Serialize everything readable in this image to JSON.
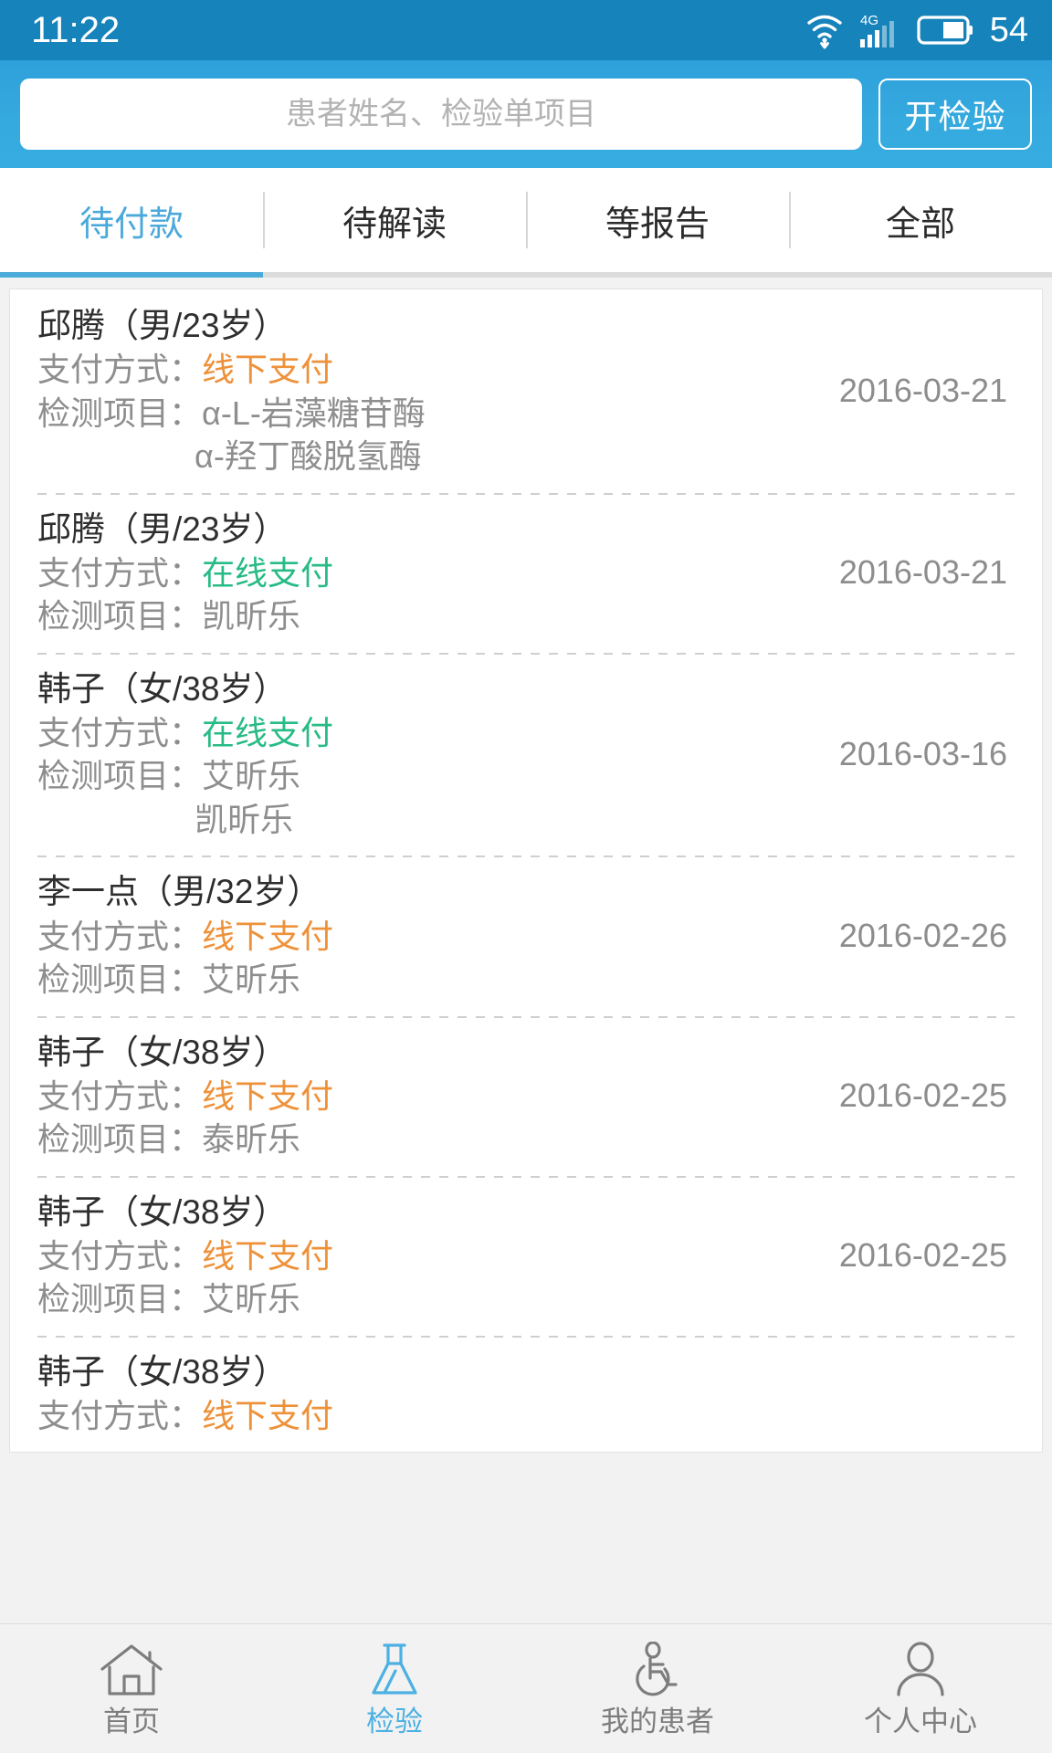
{
  "status_bar": {
    "time": "11:22",
    "battery_level": "54",
    "network_label": "4G",
    "icons": [
      "wifi-download-icon",
      "signal-4g-icon",
      "battery-icon"
    ]
  },
  "header": {
    "search_placeholder": "患者姓名、检验单项目",
    "search_value": "",
    "action_button": "开检验"
  },
  "tabs": {
    "items": [
      {
        "label": "待付款",
        "active": true
      },
      {
        "label": "待解读",
        "active": false
      },
      {
        "label": "等报告",
        "active": false
      },
      {
        "label": "全部",
        "active": false
      }
    ]
  },
  "labels": {
    "payment_prefix": "支付方式：",
    "items_prefix": "检测项目："
  },
  "colors": {
    "status_bar_bg": "#1783bb",
    "header_bg": "#35aade",
    "accent": "#4bacd9",
    "offline_pay": "#ee9139",
    "online_pay": "#27bb85",
    "text_primary": "#2e2e2e",
    "text_secondary": "#8e8e8e"
  },
  "list": {
    "rows": [
      {
        "patient": "邱腾（男/23岁）",
        "payment": "线下支付",
        "payment_type": "offline",
        "items": [
          "α-L-岩藻糖苷酶",
          "α-羟丁酸脱氢酶"
        ],
        "date": "2016-03-21"
      },
      {
        "patient": "邱腾（男/23岁）",
        "payment": "在线支付",
        "payment_type": "online",
        "items": [
          "凯昕乐"
        ],
        "date": "2016-03-21"
      },
      {
        "patient": "韩子（女/38岁）",
        "payment": "在线支付",
        "payment_type": "online",
        "items": [
          "艾昕乐",
          "凯昕乐"
        ],
        "date": "2016-03-16"
      },
      {
        "patient": "李一点（男/32岁）",
        "payment": "线下支付",
        "payment_type": "offline",
        "items": [
          "艾昕乐"
        ],
        "date": "2016-02-26"
      },
      {
        "patient": "韩子（女/38岁）",
        "payment": "线下支付",
        "payment_type": "offline",
        "items": [
          "泰昕乐"
        ],
        "date": "2016-02-25"
      },
      {
        "patient": "韩子（女/38岁）",
        "payment": "线下支付",
        "payment_type": "offline",
        "items": [
          "艾昕乐"
        ],
        "date": "2016-02-25"
      },
      {
        "patient": "韩子（女/38岁）",
        "payment": "线下支付",
        "payment_type": "offline",
        "items": [],
        "date": ""
      }
    ]
  },
  "bottom_nav": {
    "items": [
      {
        "label": "首页",
        "icon": "home-icon",
        "active": false
      },
      {
        "label": "检验",
        "icon": "flask-icon",
        "active": true
      },
      {
        "label": "我的患者",
        "icon": "wheelchair-icon",
        "active": false
      },
      {
        "label": "个人中心",
        "icon": "person-icon",
        "active": false
      }
    ]
  }
}
